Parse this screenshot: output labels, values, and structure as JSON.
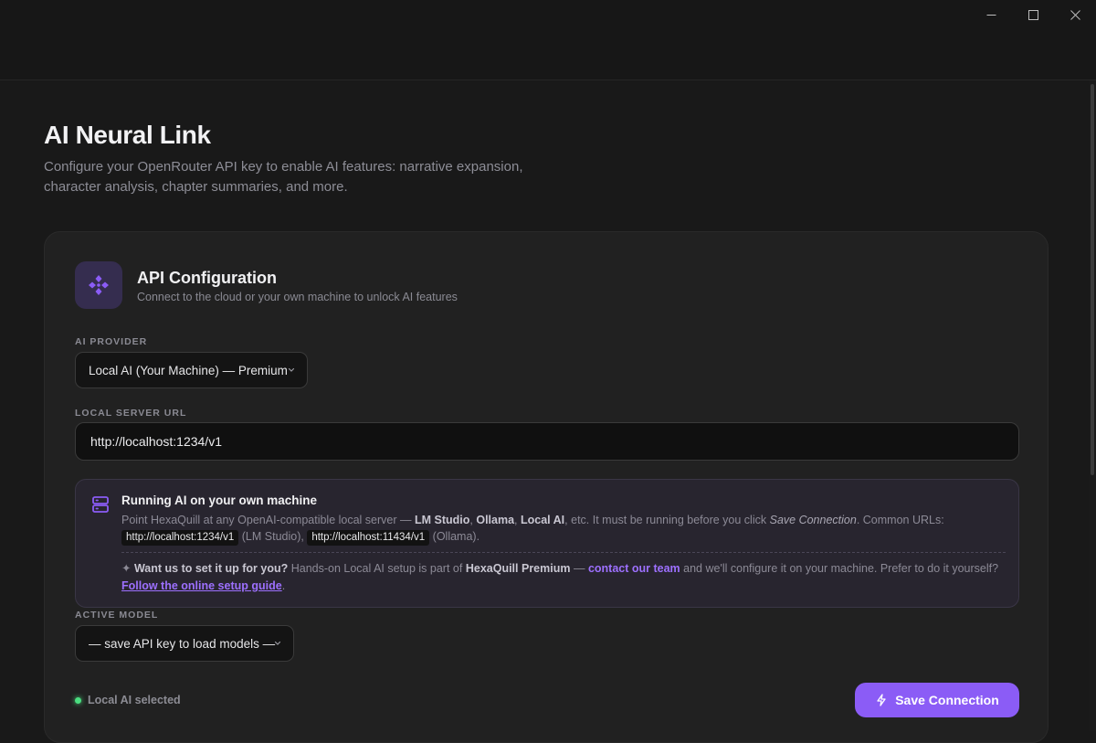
{
  "page": {
    "title": "AI Neural Link",
    "description": "Configure your OpenRouter API key to enable AI features: narrative expansion, character analysis, chapter summaries, and more."
  },
  "card": {
    "title": "API Configuration",
    "subtitle": "Connect to the cloud or your own machine to unlock AI features",
    "icon": "hexagon-network-icon"
  },
  "provider": {
    "label": "AI PROVIDER",
    "selected": "Local AI (Your Machine) — Premium"
  },
  "server_url": {
    "label": "LOCAL SERVER URL",
    "value": "http://localhost:1234/v1"
  },
  "info": {
    "icon": "server-icon",
    "title": "Running AI on your own machine",
    "line_intro": "Point HexaQuill at any OpenAI-compatible local server —",
    "lm_studio": "LM Studio",
    "ollama": "Ollama",
    "local_ai": "Local AI",
    "line_mid": ", etc. It must be running before you click",
    "save_connection_ref": "Save Connection",
    "common_urls": ". Common URLs:",
    "url_1": "http://localhost:1234/v1",
    "url_1_note": "(LM Studio),",
    "url_2": "http://localhost:11434/v1",
    "url_2_note": "(Ollama).",
    "premium_prefix": "✦",
    "premium_question": "Want us to set it up for you?",
    "premium_text": "Hands-on Local AI setup is part of",
    "premium_product": "HexaQuill Premium",
    "premium_dash": "—",
    "contact_link": "contact our team",
    "premium_after": "and we'll configure it on your machine. Prefer to do it yourself?",
    "guide_link": "Follow the online setup guide",
    "guide_end": "."
  },
  "model": {
    "label": "ACTIVE MODEL",
    "selected": "— save API key to load models —"
  },
  "status": {
    "text": "Local AI selected",
    "color": "#4ade80"
  },
  "actions": {
    "save_label": "Save Connection"
  },
  "colors": {
    "accent": "#8b5cf6",
    "background": "#191919",
    "card": "#212121"
  }
}
